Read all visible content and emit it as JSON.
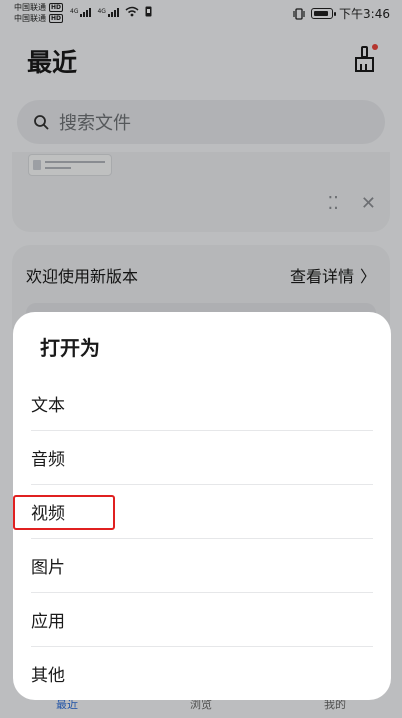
{
  "status_bar": {
    "carrier1": "中国联通",
    "carrier2": "中国联通",
    "hd": "HD",
    "signal_label": "4G",
    "time": "下午3:46"
  },
  "header": {
    "title": "最近",
    "clean_icon": "broom-icon"
  },
  "search": {
    "placeholder": "搜索文件",
    "icon": "search-icon"
  },
  "recent_card": {
    "tools": [
      "grid-dots-icon",
      "close-icon"
    ]
  },
  "version_card": {
    "text": "欢迎使用新版本",
    "link": "查看详情"
  },
  "bottom_nav": {
    "items": [
      {
        "label": "最近",
        "active": true
      },
      {
        "label": "浏览",
        "active": false
      },
      {
        "label": "我的",
        "active": false
      }
    ]
  },
  "open_as_sheet": {
    "title": "打开为",
    "options": [
      "文本",
      "音频",
      "视频",
      "图片",
      "应用",
      "其他"
    ],
    "highlighted_option": "视频"
  },
  "colors": {
    "accent": "#2a6bd6",
    "highlight_border": "#e02020",
    "notification_dot": "#e8453c"
  }
}
